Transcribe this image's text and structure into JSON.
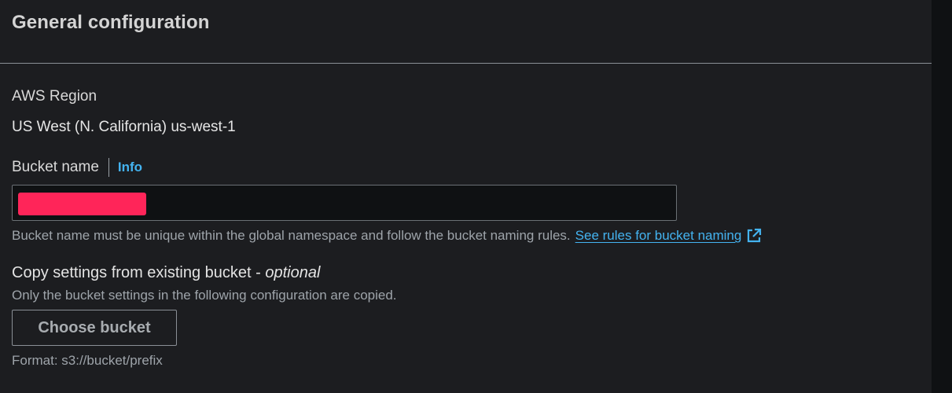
{
  "section": {
    "title": "General configuration"
  },
  "region": {
    "label": "AWS Region",
    "value": "US West (N. California) us-west-1"
  },
  "bucket_name": {
    "label": "Bucket name",
    "info_link": "Info",
    "input_value_redacted": true,
    "redaction_color": "#ff2559",
    "helper_text": "Bucket name must be unique within the global namespace and follow the bucket naming rules.",
    "rules_link": "See rules for bucket naming",
    "rules_link_icon": "external-link-icon"
  },
  "copy_settings": {
    "label": "Copy settings from existing bucket - ",
    "label_optional": "optional",
    "description": "Only the bucket settings in the following configuration are copied.",
    "button_label": "Choose bucket",
    "format_hint": "Format: s3://bucket/prefix"
  },
  "colors": {
    "background": "#1c1d20",
    "link": "#44b3f0",
    "muted_text": "#9ea4aa"
  }
}
